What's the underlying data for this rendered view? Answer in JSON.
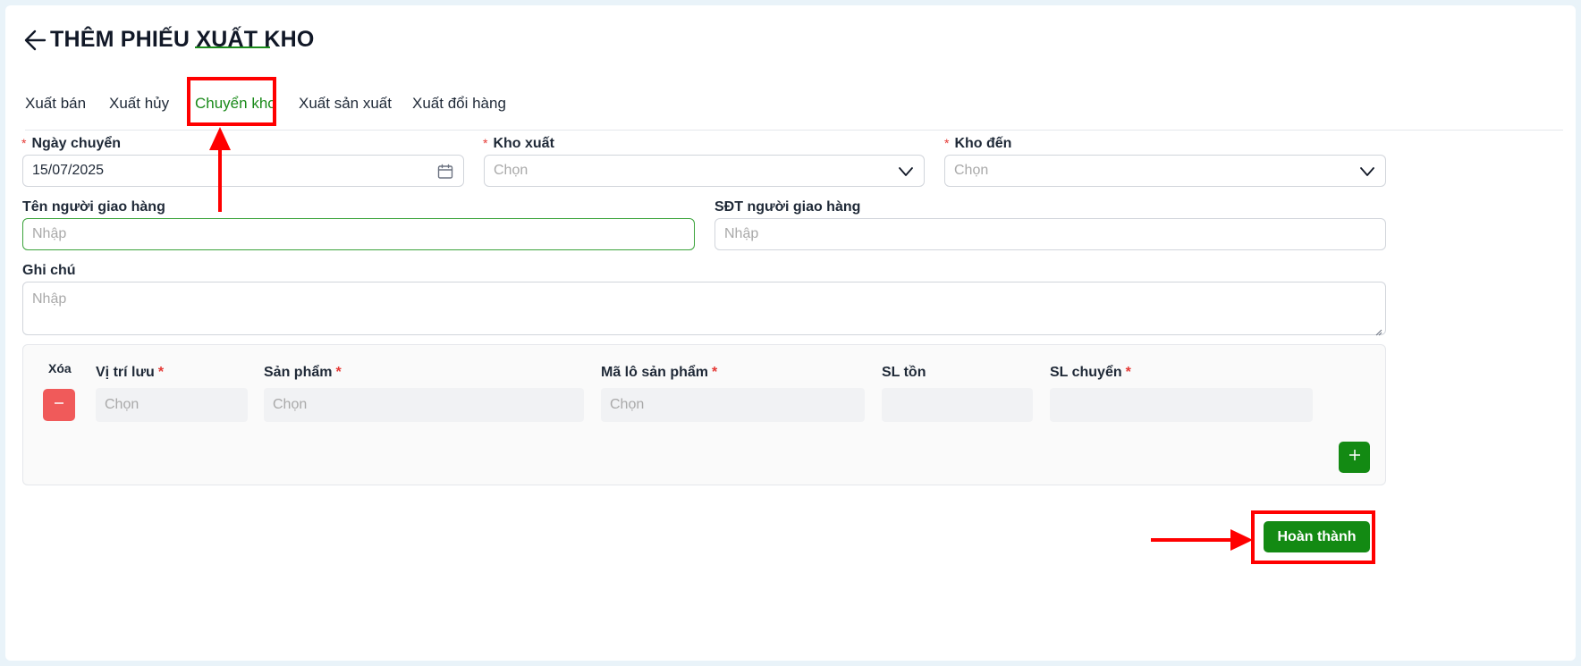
{
  "page": {
    "title": "THÊM PHIẾU XUẤT KHO"
  },
  "tabs": [
    {
      "label": "Xuất bán",
      "active": false
    },
    {
      "label": "Xuất hủy",
      "active": false
    },
    {
      "label": "Chuyển kho",
      "active": true
    },
    {
      "label": "Xuất sản xuất",
      "active": false
    },
    {
      "label": "Xuất đổi hàng",
      "active": false
    }
  ],
  "form": {
    "transfer_date": {
      "label": "Ngày chuyển",
      "required": true,
      "value": "15/07/2025"
    },
    "source_warehouse": {
      "label": "Kho xuất",
      "required": true,
      "placeholder": "Chọn"
    },
    "dest_warehouse": {
      "label": "Kho đến",
      "required": true,
      "placeholder": "Chọn"
    },
    "deliverer_name": {
      "label": "Tên người giao hàng",
      "placeholder": "Nhập"
    },
    "deliverer_phone": {
      "label": "SĐT người giao hàng",
      "placeholder": "Nhập"
    },
    "note": {
      "label": "Ghi chú",
      "placeholder": "Nhập"
    }
  },
  "items_table": {
    "columns": {
      "delete": "Xóa",
      "location": "Vị trí lưu",
      "product": "Sản phẩm",
      "lot": "Mã lô sản phẩm",
      "stock_qty": "SL tồn",
      "transfer_qty": "SL chuyển"
    },
    "required_marker": "*",
    "rows": [
      {
        "location": "Chọn",
        "product": "Chọn",
        "lot": "Chọn",
        "stock_qty": "",
        "transfer_qty": ""
      }
    ]
  },
  "actions": {
    "submit_label": "Hoàn thành"
  },
  "colors": {
    "accent_green": "#138a13",
    "delete_red": "#f05a5a",
    "annotation_red": "#ff0000"
  },
  "icons": [
    "back-arrow-icon",
    "calendar-icon",
    "chevron-down-icon",
    "minus-icon",
    "plus-icon"
  ]
}
